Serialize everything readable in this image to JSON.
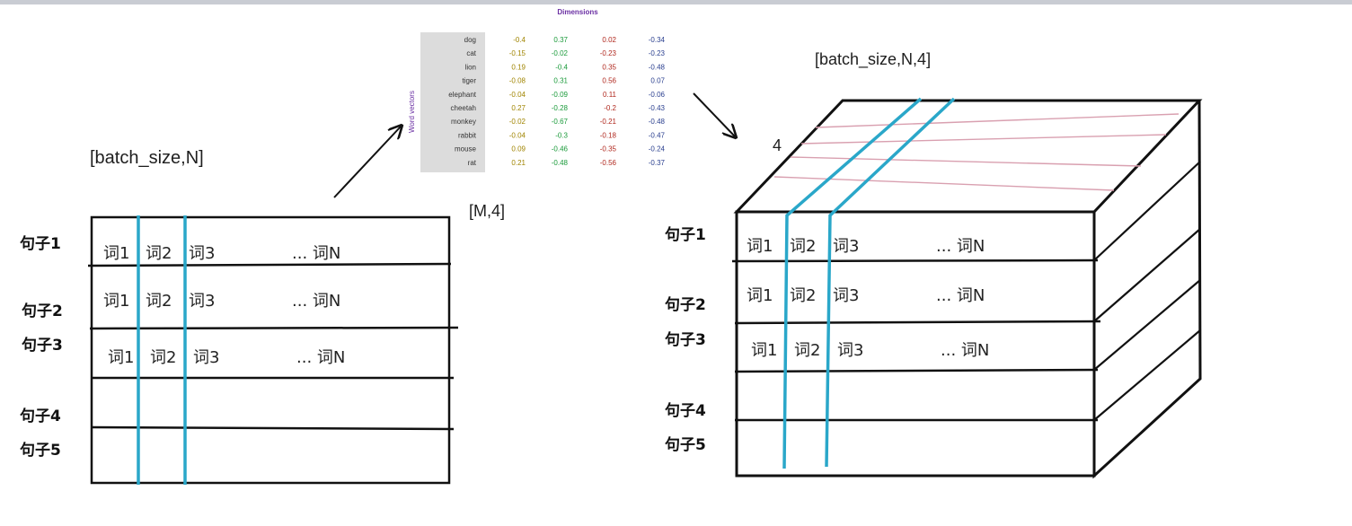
{
  "word_vectors": {
    "dimensions_title": "Dimensions",
    "axis_label": "Word vectors",
    "words": [
      "dog",
      "cat",
      "lion",
      "tiger",
      "elephant",
      "cheetah",
      "monkey",
      "rabbit",
      "mouse",
      "rat"
    ],
    "values": [
      [
        "-0.4",
        "0.37",
        "0.02",
        "-0.34"
      ],
      [
        "-0.15",
        "-0.02",
        "-0.23",
        "-0.23"
      ],
      [
        "0.19",
        "-0.4",
        "0.35",
        "-0.48"
      ],
      [
        "-0.08",
        "0.31",
        "0.56",
        "0.07"
      ],
      [
        "-0.04",
        "-0.09",
        "0.11",
        "-0.06"
      ],
      [
        "0.27",
        "-0.28",
        "-0.2",
        "-0.43"
      ],
      [
        "-0.02",
        "-0.67",
        "-0.21",
        "-0.48"
      ],
      [
        "-0.04",
        "-0.3",
        "-0.18",
        "-0.47"
      ],
      [
        "0.09",
        "-0.46",
        "-0.35",
        "-0.24"
      ],
      [
        "0.21",
        "-0.48",
        "-0.56",
        "-0.37"
      ]
    ],
    "column_colors": [
      "#a08400",
      "#1a9a3a",
      "#b0281e",
      "#2a3f8f"
    ],
    "shape_label": "[M,4]"
  },
  "left_matrix": {
    "shape_label": "[batch_size,N]",
    "sentences": [
      "句子1",
      "句子2",
      "句子3",
      "句子4",
      "句子5"
    ],
    "words": [
      "词1",
      "词2",
      "词3",
      "... 词N"
    ]
  },
  "right_tensor": {
    "shape_label": "[batch_size,N,4]",
    "depth_label": "4",
    "sentences": [
      "句子1",
      "句子2",
      "句子3",
      "句子4",
      "句子5"
    ],
    "words": [
      "词1",
      "词2",
      "词3",
      "... 词N"
    ]
  },
  "colors": {
    "highlight_line": "#2aa7c9",
    "depth_line": "#d9a0b0",
    "panel_bg": "#dcdcdc",
    "ink": "#111111"
  }
}
